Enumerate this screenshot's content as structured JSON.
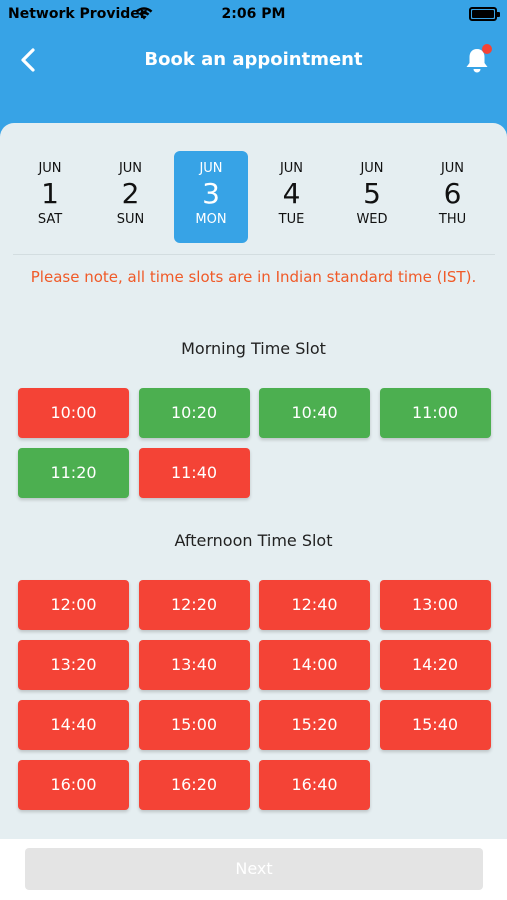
{
  "status_bar": {
    "carrier": "Network Provider",
    "time": "2:06 PM"
  },
  "header": {
    "title": "Book an appointment",
    "back_icon": "chevron-left-icon",
    "notification_icon": "bell-icon"
  },
  "dates": [
    {
      "month": "JUN",
      "day": "1",
      "weekday": "SAT",
      "selected": false
    },
    {
      "month": "JUN",
      "day": "2",
      "weekday": "SUN",
      "selected": false
    },
    {
      "month": "JUN",
      "day": "3",
      "weekday": "MON",
      "selected": true
    },
    {
      "month": "JUN",
      "day": "4",
      "weekday": "TUE",
      "selected": false
    },
    {
      "month": "JUN",
      "day": "5",
      "weekday": "WED",
      "selected": false
    },
    {
      "month": "JUN",
      "day": "6",
      "weekday": "THU",
      "selected": false
    }
  ],
  "note": "Please note, all time slots are in Indian standard time (IST).",
  "morning": {
    "title": "Morning Time Slot",
    "slots": [
      {
        "time": "10:00",
        "status": "booked"
      },
      {
        "time": "10:20",
        "status": "available"
      },
      {
        "time": "10:40",
        "status": "available"
      },
      {
        "time": "11:00",
        "status": "available"
      },
      {
        "time": "11:20",
        "status": "available"
      },
      {
        "time": "11:40",
        "status": "booked"
      }
    ]
  },
  "afternoon": {
    "title": "Afternoon Time Slot",
    "slots": [
      {
        "time": "12:00",
        "status": "booked"
      },
      {
        "time": "12:20",
        "status": "booked"
      },
      {
        "time": "12:40",
        "status": "booked"
      },
      {
        "time": "13:00",
        "status": "booked"
      },
      {
        "time": "13:20",
        "status": "booked"
      },
      {
        "time": "13:40",
        "status": "booked"
      },
      {
        "time": "14:00",
        "status": "booked"
      },
      {
        "time": "14:20",
        "status": "booked"
      },
      {
        "time": "14:40",
        "status": "booked"
      },
      {
        "time": "15:00",
        "status": "booked"
      },
      {
        "time": "15:20",
        "status": "booked"
      },
      {
        "time": "15:40",
        "status": "booked"
      },
      {
        "time": "16:00",
        "status": "booked"
      },
      {
        "time": "16:20",
        "status": "booked"
      },
      {
        "time": "16:40",
        "status": "booked"
      }
    ]
  },
  "footer": {
    "next_label": "Next"
  },
  "colors": {
    "header": "#37a3e6",
    "booked": "#f44336",
    "available": "#4caf50",
    "note": "#f05a28"
  }
}
